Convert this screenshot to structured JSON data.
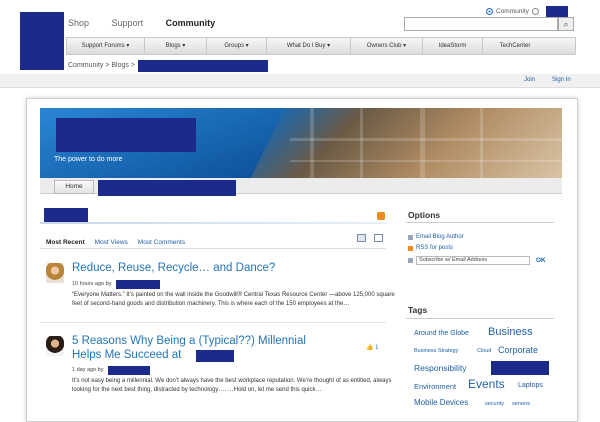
{
  "header": {
    "nav": [
      "Shop",
      "Support",
      "Community"
    ],
    "search_scope": "Community",
    "search_value": ""
  },
  "main_nav": [
    "Support Forums ▾",
    "Blogs ▾",
    "Groups ▾",
    "What Do I Buy ▾",
    "Owners Club ▾",
    "IdeaStorm",
    "TechCenter"
  ],
  "breadcrumb": "Community > Blogs >",
  "userbar": {
    "join": "Join",
    "sign_in": "Sign In"
  },
  "banner": {
    "tagline": "The power to do more"
  },
  "subnav": {
    "home": "Home"
  },
  "tabs": [
    "Most Recent",
    "Most Views",
    "Most Comments"
  ],
  "posts": [
    {
      "title": "Reduce, Reuse, Recycle… and Dance?",
      "meta": "10 hours ago by",
      "excerpt": "“Everyone Matters.” It’s painted on the wall inside the Goodwill® Central Texas Resource Center —above 125,000 square feet of second-hand goods and distribution machinery. This is where each of the 150 employees at the…"
    },
    {
      "title_line1": "5 Reasons Why Being a (Typical??) Millennial",
      "title_line2": "Helps Me Succeed at",
      "meta": "1 day ago by",
      "likes": "1",
      "excerpt": "It’s not easy being a millennial. We don’t always have the best workplace reputation. We’re thought of as entitled, always looking for the next best thing, distracted by technology…. …Hold on, let me send this quick…"
    }
  ],
  "options": {
    "title": "Options",
    "items": [
      "Email Blog Author",
      "RSS for posts"
    ],
    "subscribe_placeholder": "Subscribe w/ Email Address",
    "ok": "OK"
  },
  "tags": {
    "title": "Tags",
    "items": [
      "Around the Globe",
      "Business",
      "Business Strategy",
      "Cloud",
      "Corporate",
      "Responsibility",
      "Environment",
      "Events",
      "Laptops",
      "Mobile Devices",
      "security",
      "servers"
    ]
  },
  "colors": {
    "link": "#1f5fa8",
    "redaction": "#1c2a8c",
    "banner_blue": "#1769b4"
  }
}
